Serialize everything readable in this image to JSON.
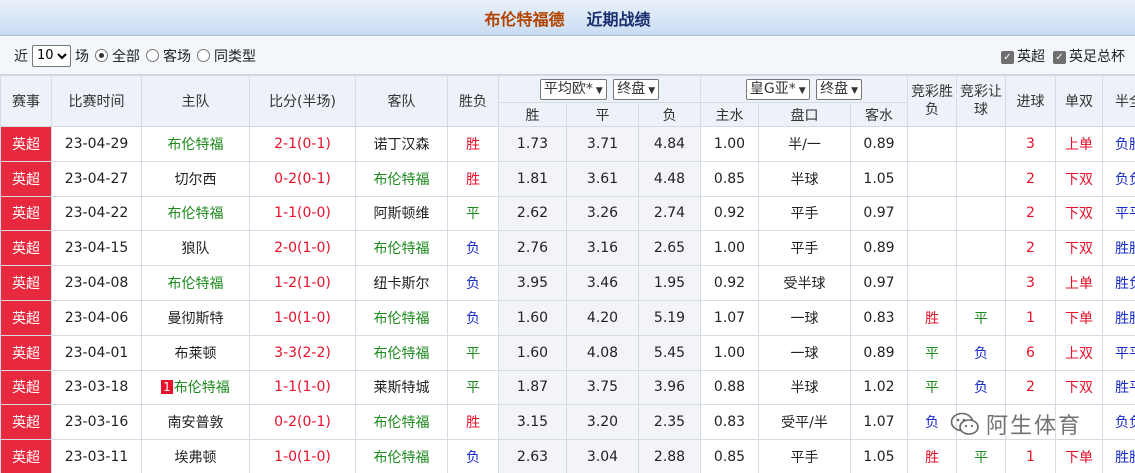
{
  "header": {
    "team": "布伦特福德",
    "section": "近期战绩"
  },
  "filter": {
    "prefix": "近",
    "count_value": "10",
    "suffix": "场",
    "radios": [
      "全部",
      "客场",
      "同类型"
    ],
    "checkboxes": [
      "英超",
      "英足总杯"
    ]
  },
  "table": {
    "columns": [
      "赛事",
      "比赛时间",
      "主队",
      "比分(半场)",
      "客队",
      "胜负"
    ],
    "euro_select": "平均欧*",
    "euro_final": "终盘",
    "euro_sub": [
      "胜",
      "平",
      "负"
    ],
    "asia_select": "皇G亚*",
    "asia_final": "终盘",
    "asia_sub": [
      "主水",
      "盘口",
      "客水"
    ],
    "extra_cols": [
      "竞彩胜负",
      "竞彩让球",
      "进球",
      "单双",
      "半全"
    ],
    "rows": [
      {
        "league": "英超",
        "date": "23-04-29",
        "home": "布伦特福",
        "away": "诺丁汉森",
        "score": "2-1",
        "half": "(0-1)",
        "result": "胜",
        "w": "1.73",
        "d": "3.71",
        "l": "4.84",
        "hw": "1.00",
        "line": "半/一",
        "aw": "0.89",
        "jc": "",
        "jr": "",
        "goals": "3",
        "oe": "上单",
        "hf": "负胜"
      },
      {
        "league": "英超",
        "date": "23-04-27",
        "home": "切尔西",
        "away": "布伦特福",
        "score": "0-2",
        "half": "(0-1)",
        "result": "胜",
        "w": "1.81",
        "d": "3.61",
        "l": "4.48",
        "hw": "0.85",
        "line": "半球",
        "aw": "1.05",
        "jc": "",
        "jr": "",
        "goals": "2",
        "oe": "下双",
        "hf": "负负"
      },
      {
        "league": "英超",
        "date": "23-04-22",
        "home": "布伦特福",
        "away": "阿斯顿维",
        "score": "1-1",
        "half": "(0-0)",
        "result": "平",
        "w": "2.62",
        "d": "3.26",
        "l": "2.74",
        "hw": "0.92",
        "line": "平手",
        "aw": "0.97",
        "jc": "",
        "jr": "",
        "goals": "2",
        "oe": "下双",
        "hf": "平平"
      },
      {
        "league": "英超",
        "date": "23-04-15",
        "home": "狼队",
        "away": "布伦特福",
        "score": "2-0",
        "half": "(1-0)",
        "result": "负",
        "w": "2.76",
        "d": "3.16",
        "l": "2.65",
        "hw": "1.00",
        "line": "平手",
        "aw": "0.89",
        "jc": "",
        "jr": "",
        "goals": "2",
        "oe": "下双",
        "hf": "胜胜"
      },
      {
        "league": "英超",
        "date": "23-04-08",
        "home": "布伦特福",
        "away": "纽卡斯尔",
        "score": "1-2",
        "half": "(1-0)",
        "result": "负",
        "w": "3.95",
        "d": "3.46",
        "l": "1.95",
        "hw": "0.92",
        "line": "受半球",
        "aw": "0.97",
        "jc": "",
        "jr": "",
        "goals": "3",
        "oe": "上单",
        "hf": "胜负"
      },
      {
        "league": "英超",
        "date": "23-04-06",
        "home": "曼彻斯特",
        "away": "布伦特福",
        "score": "1-0",
        "half": "(1-0)",
        "result": "负",
        "w": "1.60",
        "d": "4.20",
        "l": "5.19",
        "hw": "1.07",
        "line": "一球",
        "aw": "0.83",
        "jc": "胜",
        "jr": "平",
        "goals": "1",
        "oe": "下单",
        "hf": "胜胜"
      },
      {
        "league": "英超",
        "date": "23-04-01",
        "home": "布莱顿",
        "away": "布伦特福",
        "score": "3-3",
        "half": "(2-2)",
        "result": "平",
        "w": "1.60",
        "d": "4.08",
        "l": "5.45",
        "hw": "1.00",
        "line": "一球",
        "aw": "0.89",
        "jc": "平",
        "jr": "负",
        "goals": "6",
        "oe": "上双",
        "hf": "平平"
      },
      {
        "league": "英超",
        "date": "23-03-18",
        "home": "布伦特福",
        "home_card": "1",
        "away": "莱斯特城",
        "score": "1-1",
        "half": "(1-0)",
        "result": "平",
        "w": "1.87",
        "d": "3.75",
        "l": "3.96",
        "hw": "0.88",
        "line": "半球",
        "aw": "1.02",
        "jc": "平",
        "jr": "负",
        "goals": "2",
        "oe": "下双",
        "hf": "胜平"
      },
      {
        "league": "英超",
        "date": "23-03-16",
        "home": "南安普敦",
        "away": "布伦特福",
        "score": "0-2",
        "half": "(0-1)",
        "result": "胜",
        "w": "3.15",
        "d": "3.20",
        "l": "2.35",
        "hw": "0.83",
        "line": "受平/半",
        "aw": "1.07",
        "jc": "负",
        "jr": "",
        "goals": "",
        "oe": "",
        "hf": "负负"
      },
      {
        "league": "英超",
        "date": "23-03-11",
        "home": "埃弗顿",
        "away": "布伦特福",
        "score": "1-0",
        "half": "(1-0)",
        "result": "负",
        "w": "2.63",
        "d": "3.04",
        "l": "2.88",
        "hw": "0.85",
        "line": "平手",
        "aw": "1.05",
        "jc": "胜",
        "jr": "平",
        "goals": "1",
        "oe": "下单",
        "hf": "胜胜"
      }
    ]
  },
  "watermark": "阿生体育",
  "colors": {
    "league_bg": "#e8283c",
    "win": "#e8102a",
    "draw": "#1e8a1e",
    "loss": "#1a2cc8",
    "team_highlight": "#1e8a1e"
  },
  "icons": {
    "watermark": "wechat-icon",
    "select": "chevron-down-icon"
  }
}
